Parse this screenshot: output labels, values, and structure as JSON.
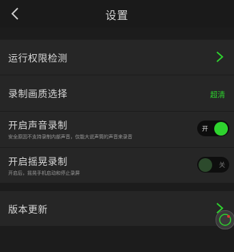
{
  "header": {
    "title": "设置",
    "back_icon": "chevron-left-icon"
  },
  "rows": [
    {
      "label": "运行权限检测",
      "icon": "chevron-right-icon"
    },
    {
      "label": "录制画质选择",
      "value": "超清"
    },
    {
      "label": "开启声音录制",
      "sub": "安全原因不支持录制内部声音，仅能大说声筒的声音来录音",
      "toggle": {
        "state": "on",
        "text": "开"
      }
    },
    {
      "label": "开启摇晃录制",
      "sub": "开启后，摇晃手机启动和停止录屏",
      "toggle": {
        "state": "off",
        "text": "关"
      }
    },
    {
      "label": "版本更新",
      "icon": "chevron-right-icon"
    }
  ],
  "floating_button": {
    "icon": "record-icon"
  },
  "colors": {
    "accent": "#2ed32e",
    "row_bg": "#262626",
    "page_bg": "#1c1c1c"
  }
}
